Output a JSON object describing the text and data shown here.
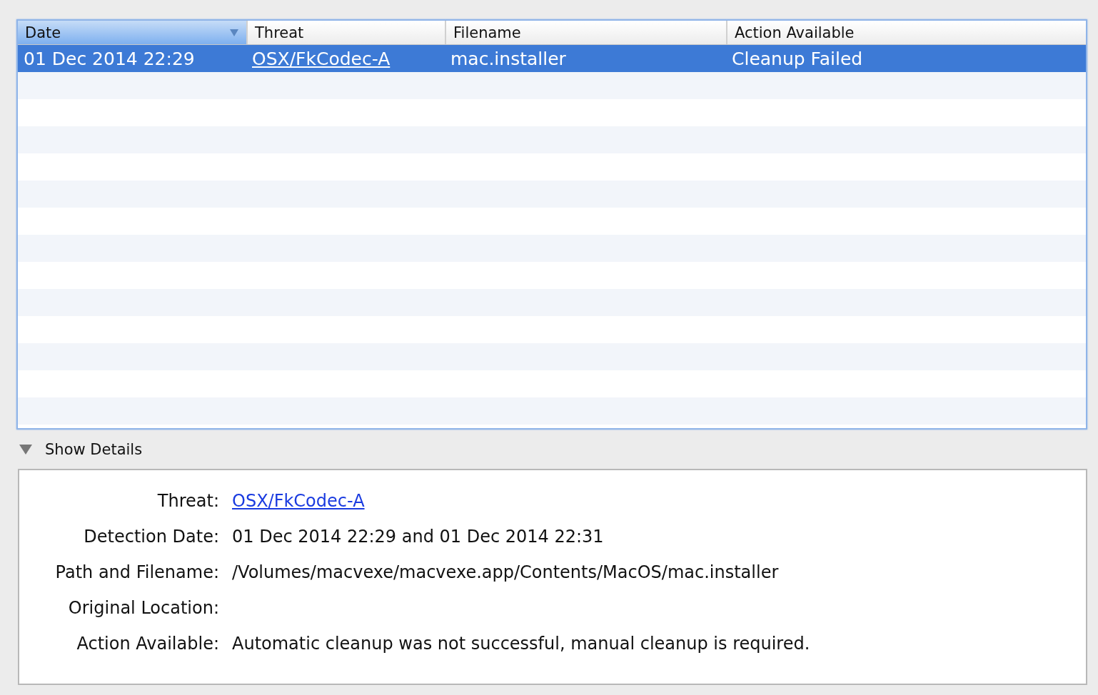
{
  "table": {
    "columns": [
      {
        "label": "Date",
        "sorted": true
      },
      {
        "label": "Threat",
        "sorted": false
      },
      {
        "label": "Filename",
        "sorted": false
      },
      {
        "label": "Action Available",
        "sorted": false
      }
    ],
    "rows": [
      {
        "selected": true,
        "cells": [
          {
            "kind": "text",
            "text": "01 Dec 2014 22:29"
          },
          {
            "kind": "link",
            "text": "OSX/FkCodec-A"
          },
          {
            "kind": "text",
            "text": "mac.installer"
          },
          {
            "kind": "text",
            "text": "Cleanup Failed"
          }
        ]
      }
    ]
  },
  "details_toggle": {
    "label": "Show Details",
    "expanded": true
  },
  "details": [
    {
      "label": "Threat:",
      "kind": "link",
      "value": "OSX/FkCodec-A"
    },
    {
      "label": "Detection Date:",
      "kind": "text",
      "value": "01 Dec 2014 22:29 and 01 Dec 2014 22:31"
    },
    {
      "label": "Path and Filename:",
      "kind": "text",
      "value": "/Volumes/macvexe/macvexe.app/Contents/MacOS/mac.installer"
    },
    {
      "label": "Original Location:",
      "kind": "empty"
    },
    {
      "label": "Action Available:",
      "kind": "text",
      "value": "Automatic cleanup was not successful, manual cleanup is required."
    }
  ]
}
